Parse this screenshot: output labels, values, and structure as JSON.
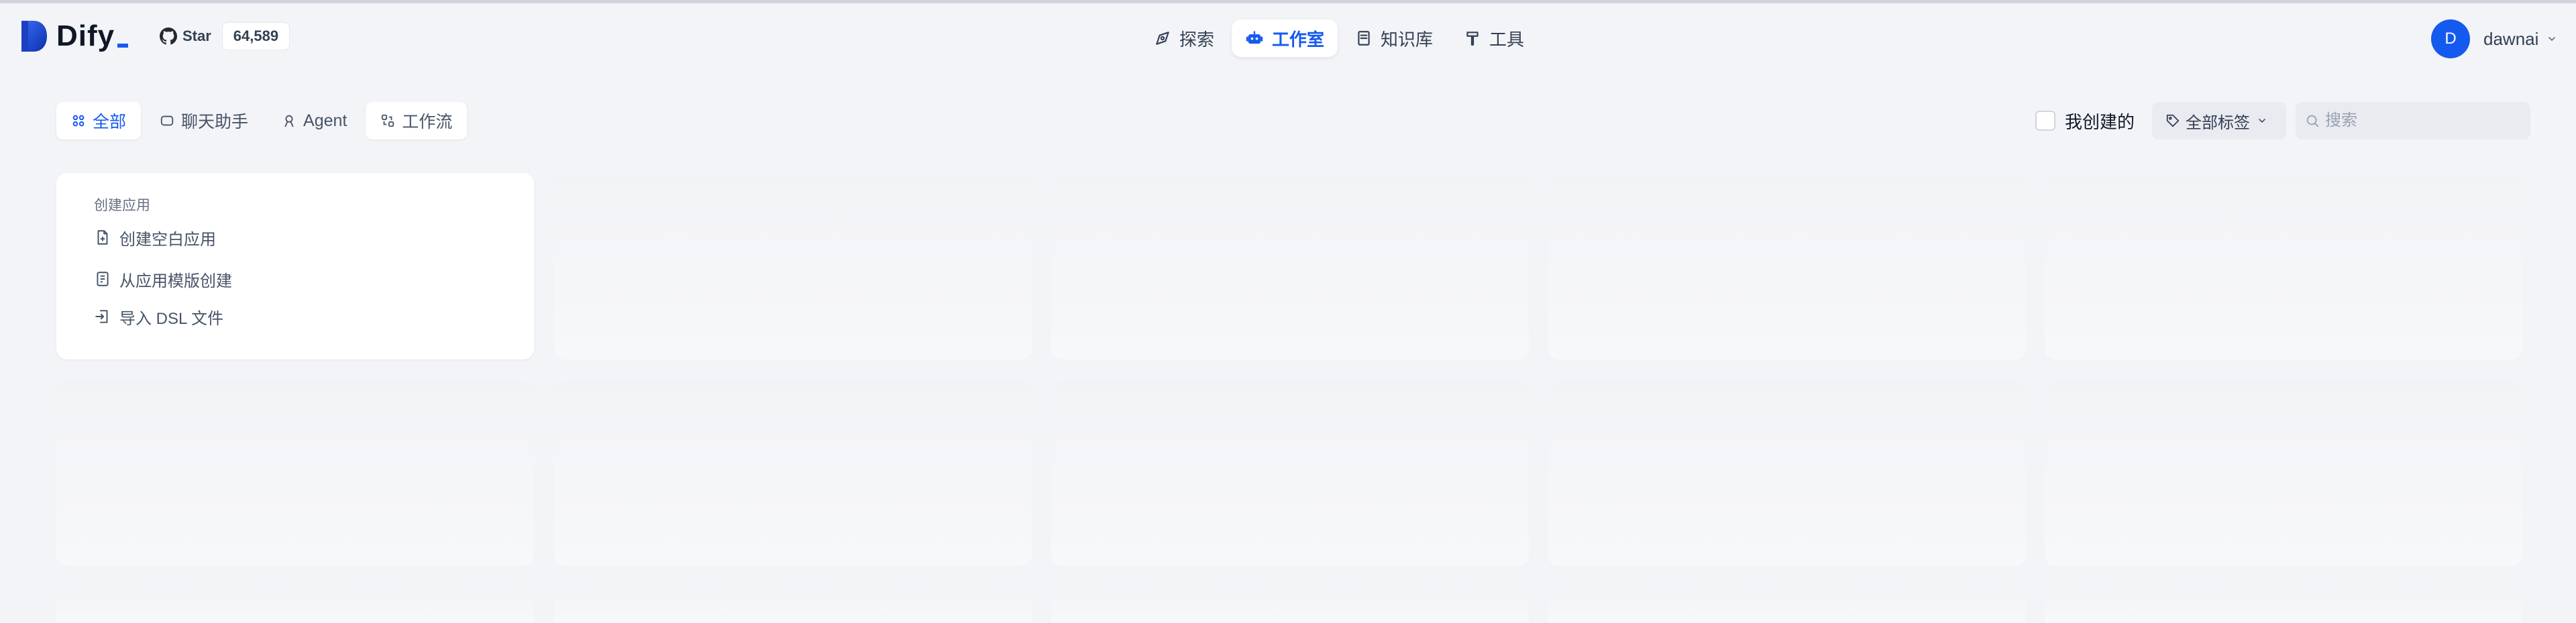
{
  "app": {
    "name": "Dify",
    "brand_color": "#155aef"
  },
  "github": {
    "label": "Star",
    "count": "64,589"
  },
  "nav": {
    "items": [
      {
        "label": "探索",
        "icon": "compass-icon"
      },
      {
        "label": "工作室",
        "icon": "robot-icon",
        "active": true
      },
      {
        "label": "知识库",
        "icon": "book-icon"
      },
      {
        "label": "工具",
        "icon": "hammer-icon"
      }
    ]
  },
  "user": {
    "initial": "D",
    "name": "dawnai"
  },
  "filters": {
    "tabs": [
      {
        "label": "全部",
        "icon": "grid-icon",
        "active": true
      },
      {
        "label": "聊天助手",
        "icon": "chat-icon"
      },
      {
        "label": "Agent",
        "icon": "agent-icon"
      },
      {
        "label": "工作流",
        "icon": "workflow-icon"
      }
    ],
    "mine_label": "我创建的",
    "mine_checked": false,
    "tags_label": "全部标签",
    "search_placeholder": "搜索"
  },
  "create_card": {
    "title": "创建应用",
    "items": [
      {
        "label": "创建空白应用",
        "icon": "file-plus-icon"
      },
      {
        "label": "从应用模版创建",
        "icon": "template-icon"
      },
      {
        "label": "导入 DSL 文件",
        "icon": "import-icon"
      }
    ]
  }
}
